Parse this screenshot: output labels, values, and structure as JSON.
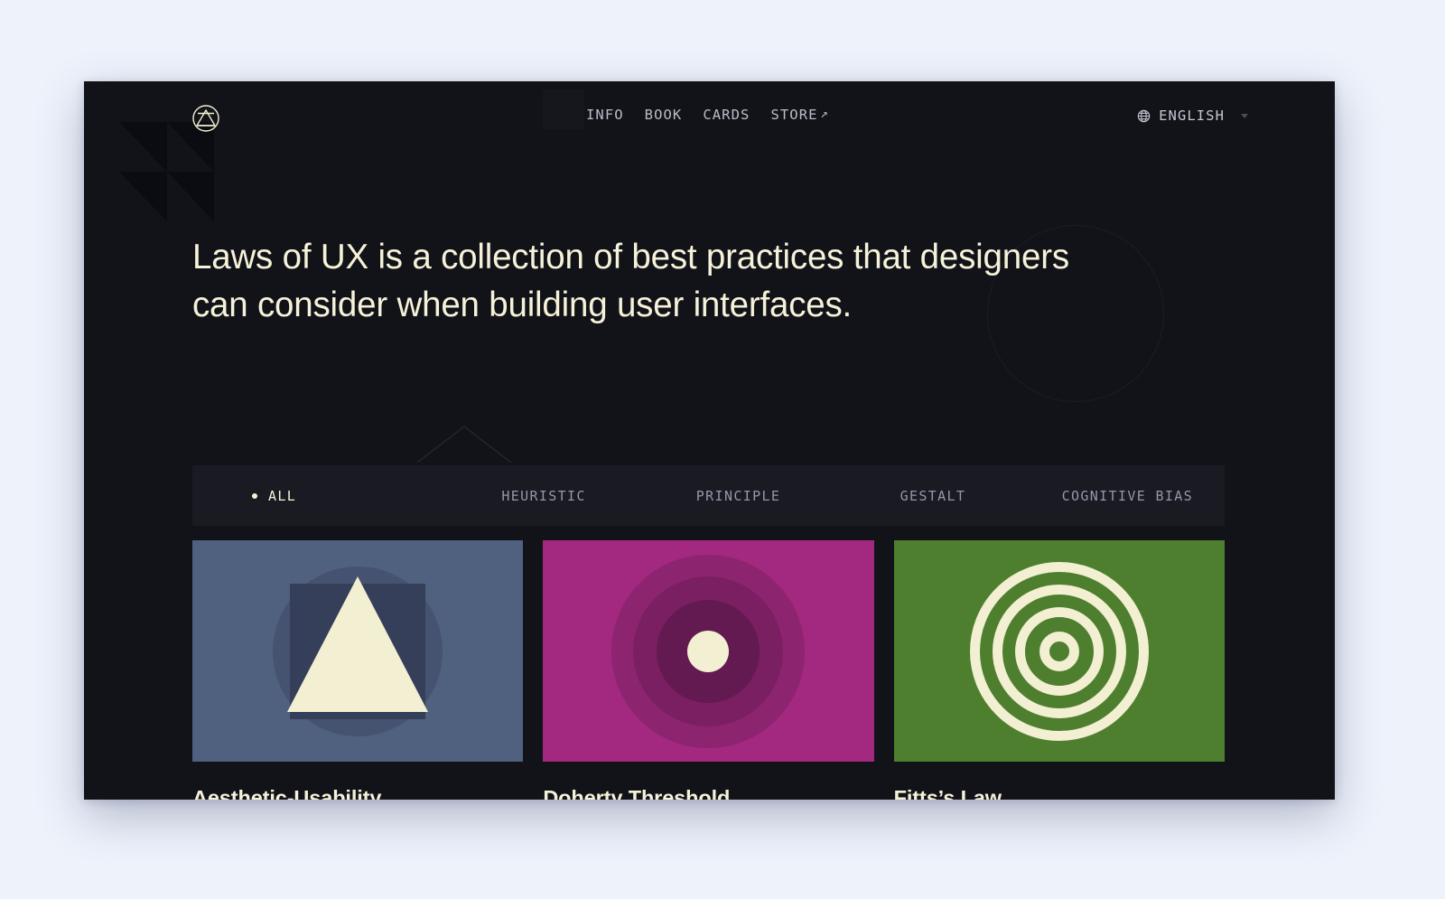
{
  "theme": {
    "page_bg": "#eef2fb",
    "canvas_bg": "#121319",
    "cream": "#f6f2d9",
    "muted_text": "#9299a8",
    "nav_text": "#b9bdc9",
    "filter_bar_bg": "#191a22"
  },
  "header": {
    "logo_name": "Laws of UX logo",
    "nav": [
      {
        "label": "INFO",
        "external": false
      },
      {
        "label": "BOOK",
        "external": false
      },
      {
        "label": "CARDS",
        "external": false
      },
      {
        "label": "STORE",
        "external": true,
        "external_glyph": "↗"
      }
    ],
    "language": {
      "icon": "globe-icon",
      "value": "ENGLISH",
      "caret": "chevron-down-icon"
    }
  },
  "hero": {
    "headline": "Laws of UX is a collection of best practices that designers can consider when building user interfaces."
  },
  "filters": {
    "active": "ALL",
    "items": [
      {
        "label": "ALL",
        "active": true
      },
      {
        "label": "HEURISTIC",
        "active": false
      },
      {
        "label": "PRINCIPLE",
        "active": false
      },
      {
        "label": "GESTALT",
        "active": false
      },
      {
        "label": "COGNITIVE BIAS",
        "active": false
      }
    ]
  },
  "cards": [
    {
      "title": "Aesthetic-Usability",
      "art": {
        "kind": "triangle-square-circle",
        "bg": "#50607f",
        "circle": "#465370",
        "square": "#363f59",
        "shape": "#f3efd2"
      }
    },
    {
      "title": "Doherty Threshold",
      "art": {
        "kind": "filled-concentric",
        "bg": "#a3287f",
        "ring1": "#8d2470",
        "ring2": "#7a1f61",
        "ring3": "#631a50",
        "center": "#f3efd2"
      }
    },
    {
      "title": "Fitts’s Law",
      "art": {
        "kind": "stroked-concentric",
        "bg": "#4e7f2e",
        "stroke": "#f3efd2"
      }
    }
  ]
}
